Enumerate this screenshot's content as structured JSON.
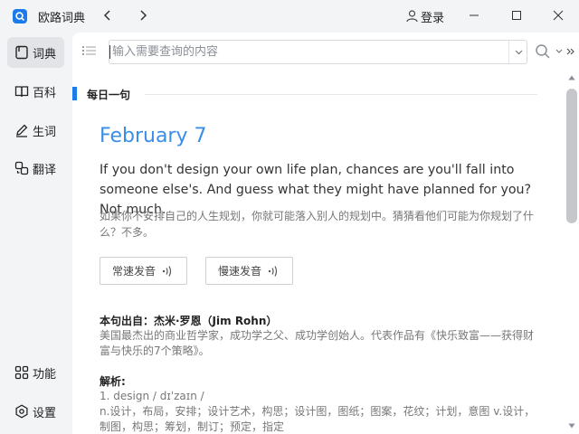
{
  "app": {
    "title": "欧路词典"
  },
  "titlebar": {
    "login_label": "登录"
  },
  "sidebar": {
    "items": [
      {
        "label": "词典",
        "icon": "book-icon"
      },
      {
        "label": "百科",
        "icon": "open-book-icon"
      },
      {
        "label": "生词",
        "icon": "pencil-icon"
      },
      {
        "label": "翻译",
        "icon": "translate-icon"
      }
    ],
    "bottom": [
      {
        "label": "功能",
        "icon": "grid-icon"
      },
      {
        "label": "设置",
        "icon": "gear-icon"
      }
    ]
  },
  "search": {
    "placeholder": "输入需要查询的内容",
    "value": ""
  },
  "daily": {
    "section_title": "每日一句",
    "date": "February 7",
    "sentence_en": "If you don't design your own life plan, chances are you'll fall into someone else's. And guess what they might have planned for you? Not much.",
    "sentence_zh": "如果你不安排自己的人生规划，你就可能落入别人的规划中。猜猜看他们可能为你规划了什么？不多。",
    "audio_normal_label": "常速发音",
    "audio_slow_label": "慢速发音",
    "source_line": "本句出自：杰米·罗恩（Jim Rohn）",
    "source_desc": "美国最杰出的商业哲学家，成功学之父、成功学创始人。代表作品有《快乐致富——获得财富与快乐的7个策略》。",
    "analysis_label": "解析:",
    "analysis_word": "1. design / dɪˈzaɪn /",
    "analysis_def": "n.设计，布局，安排；设计艺术，构思；设计图，图纸；图案，花纹；计划，意图 v.设计，制图，构思；筹划，制订；预定，指定"
  },
  "colors": {
    "accent": "#1c7bea",
    "date": "#3a8ee6"
  }
}
